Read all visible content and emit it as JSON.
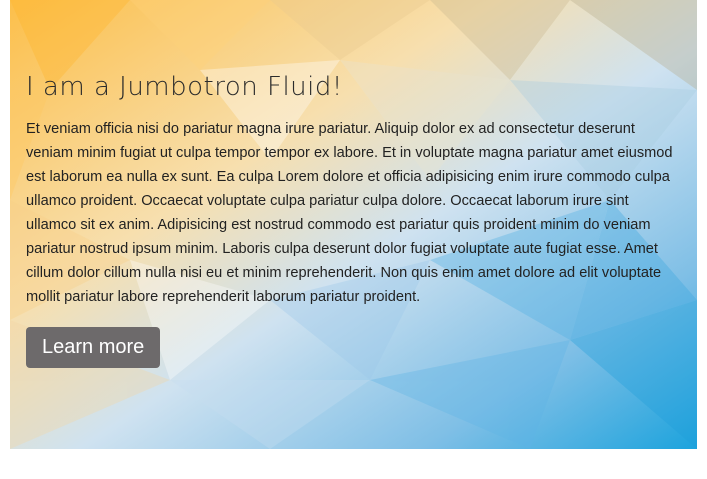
{
  "jumbotron": {
    "heading": "I am a Jumbotron Fluid!",
    "body": "Et veniam officia nisi do pariatur magna irure pariatur. Aliquip dolor ex ad consectetur deserunt veniam minim fugiat ut culpa tempor tempor ex labore. Et in voluptate magna pariatur amet eiusmod est laborum ea nulla ex sunt. Ea culpa Lorem dolore et officia adipisicing enim irure commodo culpa ullamco proident. Occaecat voluptate culpa pariatur culpa dolore. Occaecat laborum irure sint ullamco sit ex anim. Adipisicing est nostrud commodo est pariatur quis proident minim do veniam pariatur nostrud ipsum minim. Laboris culpa deserunt dolor fugiat voluptate aute fugiat esse. Amet cillum dolor cillum nulla nisi eu et minim reprehenderit. Non quis enim amet dolore ad elit voluptate mollit pariatur labore reprehenderit laborum pariatur proident.",
    "button_label": "Learn more"
  },
  "colors": {
    "background_warm": "#fbc04a",
    "background_cool": "#3aa7e0",
    "button": "#6d6a6b",
    "text": "#222222"
  }
}
